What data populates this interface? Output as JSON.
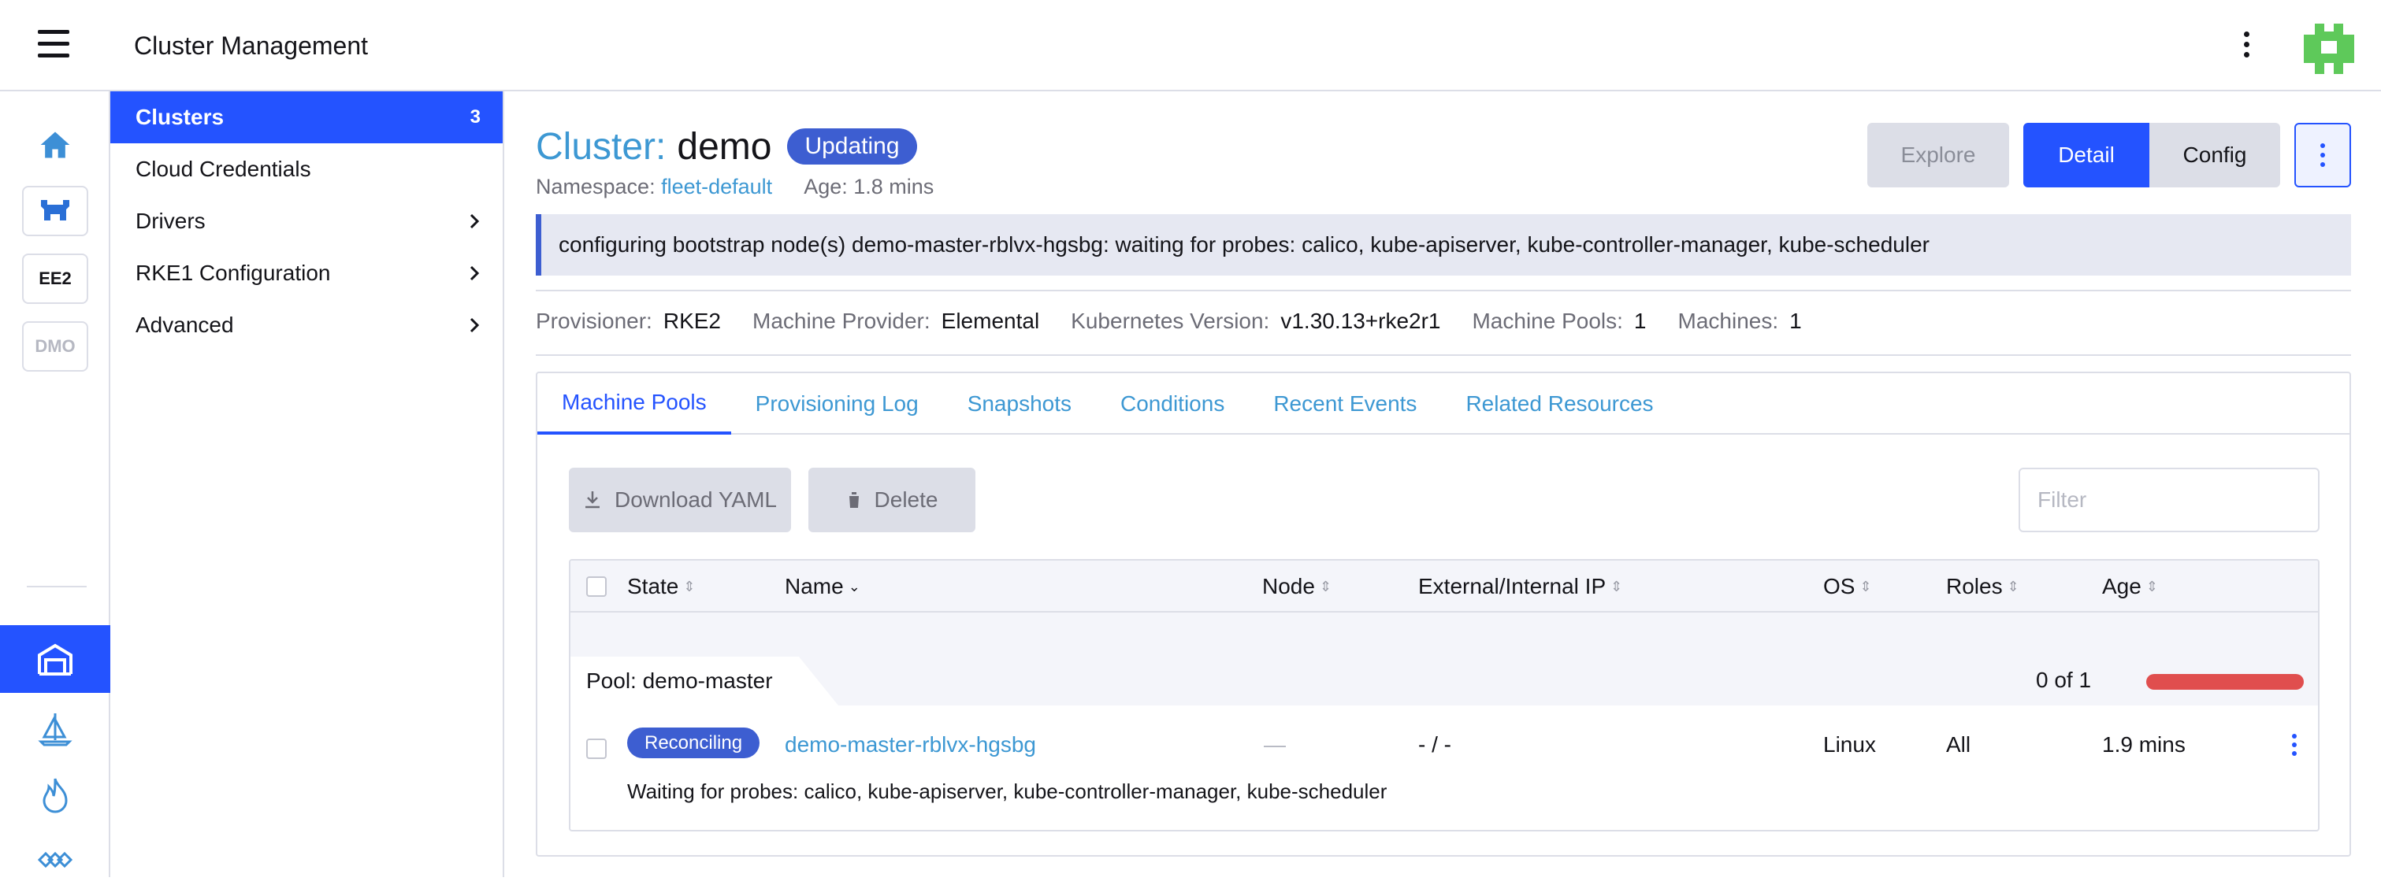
{
  "header": {
    "title": "Cluster Management"
  },
  "rail": {
    "cluster_buttons": [
      {
        "label": "EE2"
      },
      {
        "label": "DMO"
      }
    ]
  },
  "sidenav": {
    "items": [
      {
        "label": "Clusters",
        "count": "3",
        "active": true
      },
      {
        "label": "Cloud Credentials"
      },
      {
        "label": "Drivers",
        "chevron": true
      },
      {
        "label": "RKE1 Configuration",
        "chevron": true
      },
      {
        "label": "Advanced",
        "chevron": true
      }
    ]
  },
  "cluster": {
    "title_prefix": "Cluster:",
    "name": "demo",
    "status": "Updating",
    "namespace_label": "Namespace:",
    "namespace": "fleet-default",
    "age_label": "Age:",
    "age": "1.8 mins",
    "banner": "configuring bootstrap node(s) demo-master-rblvx-hgsbg: waiting for probes: calico, kube-apiserver, kube-controller-manager, kube-scheduler"
  },
  "view_buttons": {
    "explore": "Explore",
    "detail": "Detail",
    "config": "Config"
  },
  "details": [
    {
      "label": "Provisioner:",
      "value": "RKE2"
    },
    {
      "label": "Machine Provider:",
      "value": "Elemental"
    },
    {
      "label": "Kubernetes Version:",
      "value": "v1.30.13+rke2r1"
    },
    {
      "label": "Machine Pools:",
      "value": "1"
    },
    {
      "label": "Machines:",
      "value": "1"
    }
  ],
  "tabs": [
    {
      "label": "Machine Pools",
      "active": true
    },
    {
      "label": "Provisioning Log"
    },
    {
      "label": "Snapshots"
    },
    {
      "label": "Conditions"
    },
    {
      "label": "Recent Events"
    },
    {
      "label": "Related Resources"
    }
  ],
  "toolbar": {
    "download": "Download YAML",
    "delete": "Delete",
    "filter_placeholder": "Filter"
  },
  "table": {
    "columns": [
      "State",
      "Name",
      "Node",
      "External/Internal IP",
      "OS",
      "Roles",
      "Age"
    ],
    "group": {
      "label": "Pool: demo-master",
      "count": "0 of 1",
      "progress_ready_fraction": 0
    },
    "rows": [
      {
        "state": "Reconciling",
        "name": "demo-master-rblvx-hgsbg",
        "node": "—",
        "ip": "- / -",
        "os": "Linux",
        "roles": "All",
        "age": "1.9 mins",
        "message": "Waiting for probes: calico, kube-apiserver, kube-controller-manager, kube-scheduler"
      }
    ]
  },
  "colors": {
    "accent": "#2453ff",
    "link": "#3d98d3",
    "badge": "#3d5ed1",
    "error": "#e04e4e",
    "border": "#dcdee7"
  }
}
